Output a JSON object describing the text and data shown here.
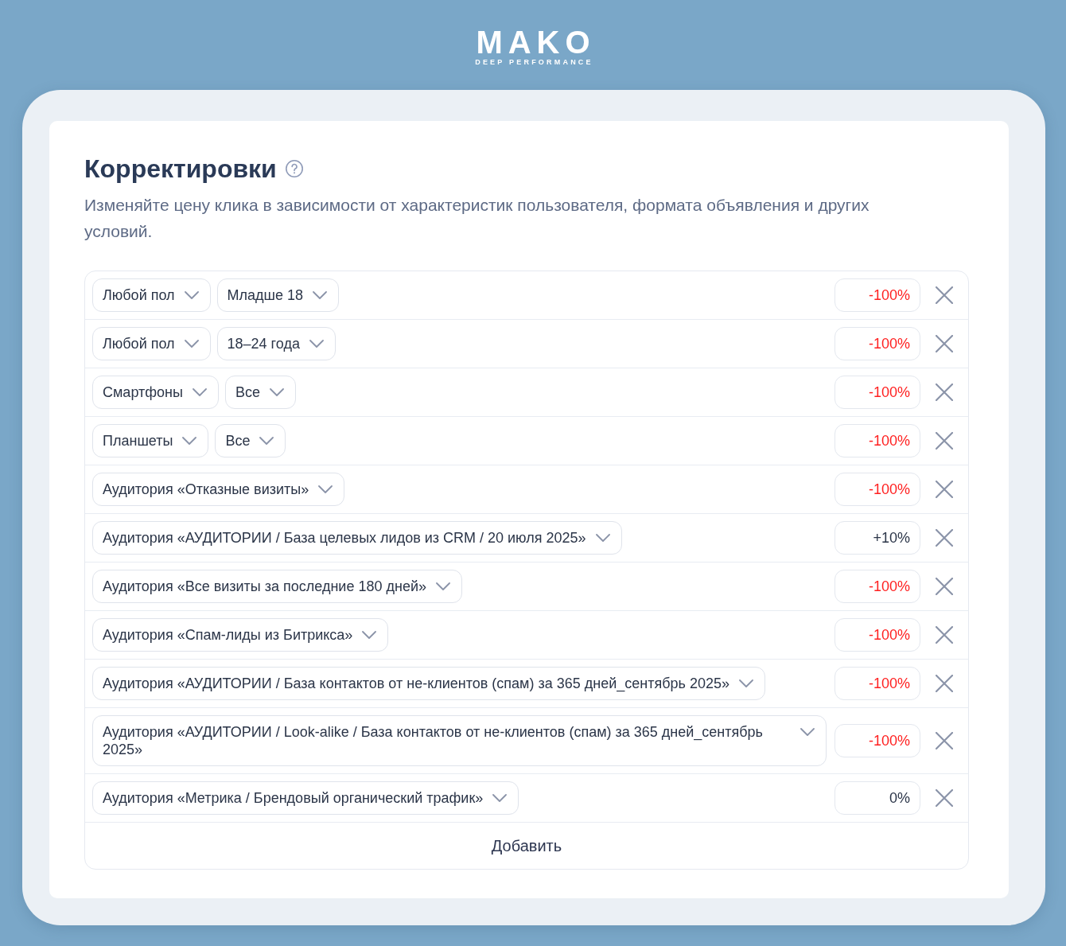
{
  "logo": {
    "name": "MAKO",
    "tagline": "DEEP PERFORMANCE"
  },
  "section": {
    "title": "Корректировки",
    "description": "Изменяйте цену клика в зависимости от характеристик пользователя, формата объявления и других условий."
  },
  "adjustments": [
    {
      "selects": [
        "Любой пол",
        "Младше 18"
      ],
      "value": "-100%",
      "negative": true
    },
    {
      "selects": [
        "Любой пол",
        "18–24 года"
      ],
      "value": "-100%",
      "negative": true
    },
    {
      "selects": [
        "Смартфоны",
        "Все"
      ],
      "value": "-100%",
      "negative": true
    },
    {
      "selects": [
        "Планшеты",
        "Все"
      ],
      "value": "-100%",
      "negative": true
    },
    {
      "selects": [
        "Аудитория «Отказные визиты»"
      ],
      "value": "-100%",
      "negative": true
    },
    {
      "selects": [
        "Аудитория «АУДИТОРИИ / База целевых лидов из CRM / 20 июля 2025»"
      ],
      "value": "+10%",
      "negative": false
    },
    {
      "selects": [
        "Аудитория «Все визиты за последние 180 дней»"
      ],
      "value": "-100%",
      "negative": true
    },
    {
      "selects": [
        "Аудитория «Спам-лиды из Битрикса»"
      ],
      "value": "-100%",
      "negative": true
    },
    {
      "selects": [
        "Аудитория «АУДИТОРИИ / База контактов от не-клиентов (спам) за 365 дней_сентябрь 2025»"
      ],
      "value": "-100%",
      "negative": true
    },
    {
      "selects": [
        "Аудитория «АУДИТОРИИ / Look-alike / База контактов от не-клиентов (спам) за 365 дней_сентябрь 2025»"
      ],
      "value": "-100%",
      "negative": true
    },
    {
      "selects": [
        "Аудитория «Метрика / Брендовый органический трафик»"
      ],
      "value": "0%",
      "negative": false
    }
  ],
  "add_button": "Добавить"
}
